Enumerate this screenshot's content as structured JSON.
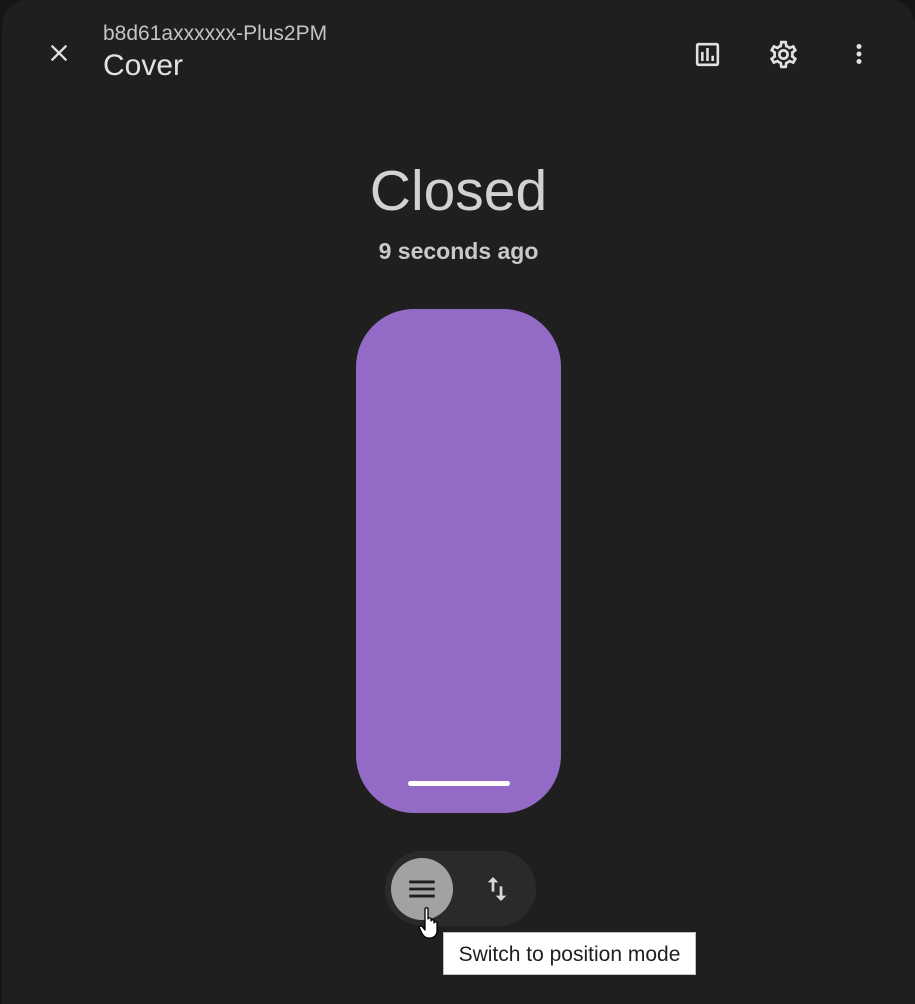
{
  "header": {
    "subtitle": "b8d61axxxxxx-Plus2PM",
    "title": "Cover",
    "icons": {
      "close": "close-icon",
      "history": "chart-box-icon",
      "settings": "cog-icon",
      "more": "dots-vertical-icon"
    }
  },
  "state": {
    "label": "Closed",
    "last_changed": "9 seconds ago"
  },
  "cover": {
    "position_percent": 0,
    "colors": {
      "fill": "#936bc7",
      "track": "#3c3444",
      "handle": "#ffffff"
    }
  },
  "mode_switch": {
    "active_mode": "button",
    "buttons": [
      {
        "icon": "menu-icon",
        "mode": "button"
      },
      {
        "icon": "swap-vertical-icon",
        "mode": "position"
      }
    ]
  },
  "tooltip": {
    "text": "Switch to position mode"
  },
  "colors": {
    "background": "#1f1f1f",
    "accent": "#936bc7"
  }
}
